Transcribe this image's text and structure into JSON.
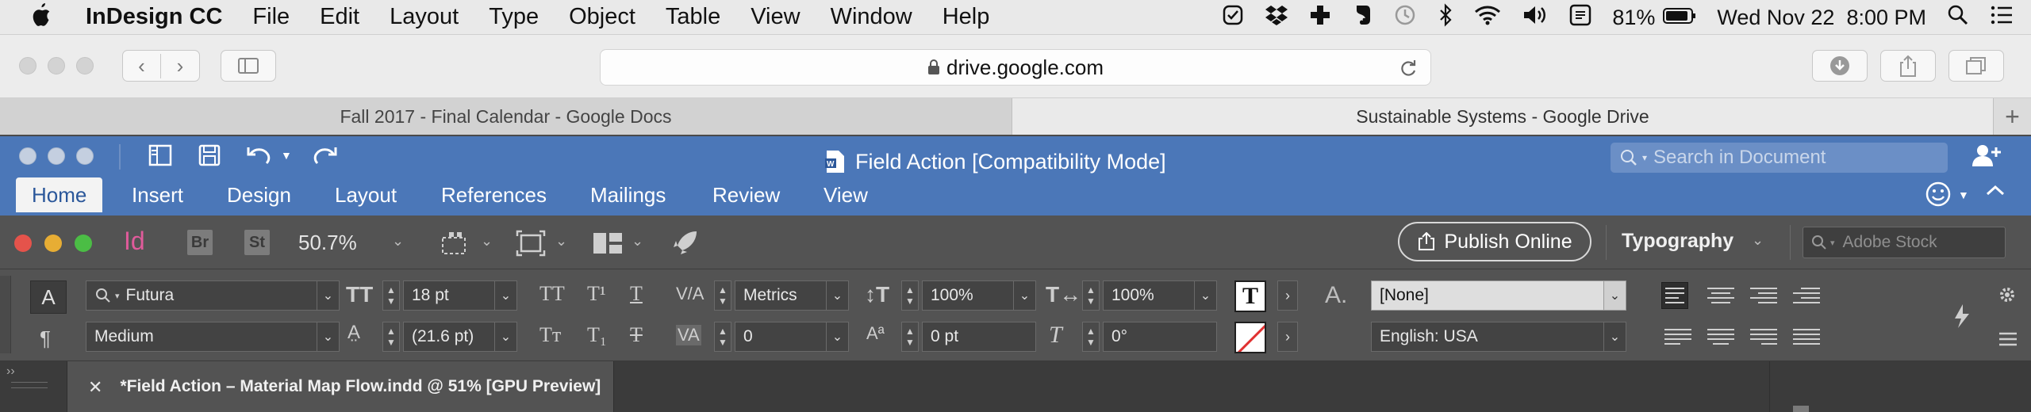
{
  "menubar": {
    "apple_icon": "apple-logo-icon",
    "items": [
      "InDesign CC",
      "File",
      "Edit",
      "Layout",
      "Type",
      "Object",
      "Table",
      "View",
      "Window",
      "Help"
    ],
    "battery": "81%",
    "datetime": "Wed Nov 22  8:00 PM"
  },
  "safari": {
    "url": "drive.google.com",
    "tabs": [
      "Fall 2017 - Final Calendar - Google Docs",
      "Sustainable Systems - Google Drive"
    ],
    "new_tab": "+"
  },
  "word": {
    "title": "Field Action [Compatibility Mode]",
    "search_placeholder": "Search in Document",
    "tabs": [
      "Home",
      "Insert",
      "Design",
      "Layout",
      "References",
      "Mailings",
      "Review",
      "View"
    ]
  },
  "indesign": {
    "logo": "Id",
    "bridge": "Br",
    "stock_app": "St",
    "zoom": "50.7%",
    "publish_label": "Publish Online",
    "workspace": "Typography",
    "stock_placeholder": "Adobe Stock",
    "control": {
      "font_family": "Futura",
      "font_style": "Medium",
      "font_size": "18 pt",
      "leading": "(21.6 pt)",
      "kerning": "Metrics",
      "tracking": "0",
      "vertical_scale": "100%",
      "horizontal_scale": "100%",
      "baseline_shift": "0 pt",
      "skew": "0°",
      "char_style": "[None]",
      "language": "English: USA"
    },
    "document_tab": "*Field Action – Material Map Flow.indd @ 51% [GPU Preview]"
  },
  "colors": {
    "word_blue": "#4b77b8",
    "indesign_panel": "#535353",
    "indesign_pink": "#e05b9b"
  }
}
